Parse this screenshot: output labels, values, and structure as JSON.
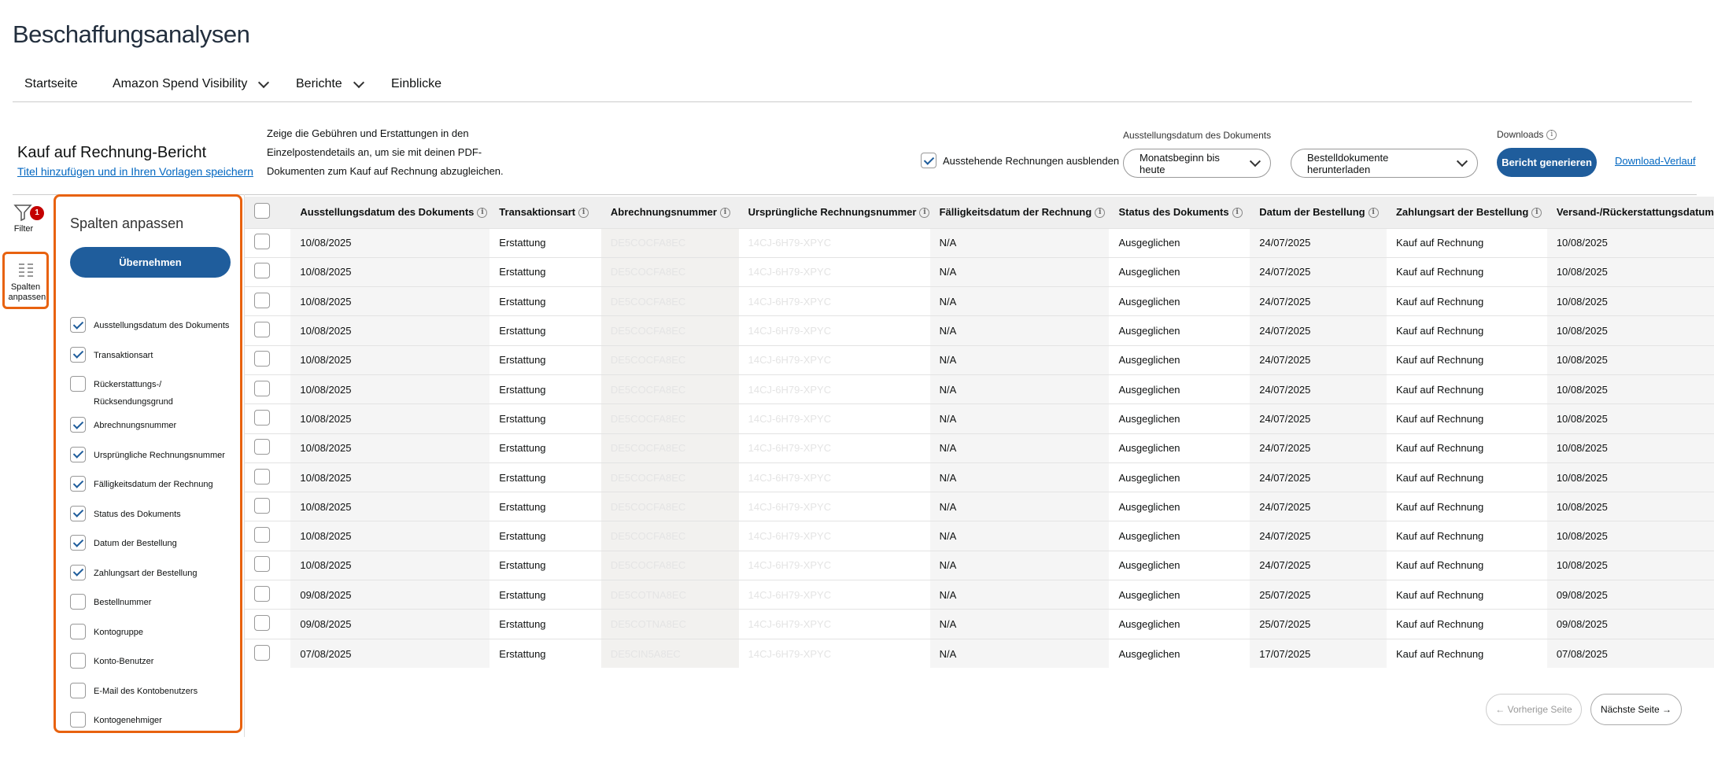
{
  "app_title": "Beschaffungsanalysen",
  "nav": [
    {
      "label": "Startseite",
      "dropdown": false
    },
    {
      "label": "Amazon Spend Visibility",
      "dropdown": true
    },
    {
      "label": "Berichte",
      "dropdown": true
    },
    {
      "label": "Einblicke",
      "dropdown": false
    }
  ],
  "report": {
    "title": "Kauf auf Rechnung-Bericht",
    "save_link": "Titel hinzufügen und in Ihren Vorlagen speichern",
    "description": "Zeige die Gebühren und Erstattungen in den Einzelpostendetails an, um sie mit deinen PDF-Dokumenten zum Kauf auf Rechnung abzugleichen."
  },
  "controls": {
    "hide_pending_label": "Ausstehende Rechnungen ausblenden",
    "hide_pending_checked": true,
    "date_label": "Ausstellungsdatum des Dokuments",
    "date_value": "Monatsbeginn bis heute",
    "docs_download": "Bestelldokumente herunterladen",
    "downloads_label": "Downloads",
    "generate_button": "Bericht generieren",
    "download_history": "Download-Verlauf"
  },
  "sidebar": {
    "filter_label": "Filter",
    "filter_count": "1",
    "columns_label": "Spalten anpassen"
  },
  "panel": {
    "title": "Spalten anpassen",
    "apply": "Übernehmen",
    "options": [
      {
        "label": "Ausstellungsdatum des Dokuments",
        "checked": true
      },
      {
        "label": "Transaktionsart",
        "checked": true
      },
      {
        "label": "Rückerstattungs-/ Rücksendungsgrund",
        "checked": false
      },
      {
        "label": "Abrechnungsnummer",
        "checked": true
      },
      {
        "label": "Ursprüngliche Rechnungsnummer",
        "checked": true
      },
      {
        "label": "Fälligkeitsdatum der Rechnung",
        "checked": true
      },
      {
        "label": "Status des Dokuments",
        "checked": true
      },
      {
        "label": "Datum der Bestellung",
        "checked": true
      },
      {
        "label": "Zahlungsart der Bestellung",
        "checked": true
      },
      {
        "label": "Bestellnummer",
        "checked": false
      },
      {
        "label": "Kontogruppe",
        "checked": false
      },
      {
        "label": "Konto-Benutzer",
        "checked": false
      },
      {
        "label": "E-Mail des Kontobenutzers",
        "checked": false
      },
      {
        "label": "Kontogenehmiger",
        "checked": false
      }
    ]
  },
  "table": {
    "columns": [
      {
        "label": "Ausstellungsdatum des Dokuments",
        "info": true
      },
      {
        "label": "Transaktionsart",
        "info": true
      },
      {
        "label": "Abrechnungsnummer",
        "info": true
      },
      {
        "label": "Ursprüngliche Rechnungsnummer",
        "info": true
      },
      {
        "label": "Fälligkeitsdatum der Rechnung",
        "info": true
      },
      {
        "label": "Status des Dokuments",
        "info": true
      },
      {
        "label": "Datum der Bestellung",
        "info": true
      },
      {
        "label": "Zahlungsart der Bestellung",
        "info": true
      },
      {
        "label": "Versand-/Rückerstattungsdatum",
        "info": false
      }
    ],
    "rows": [
      [
        "10/08/2025",
        "Erstattung",
        "DE5COCFA8EC",
        "14CJ-6H79-XPYC",
        "N/A",
        "Ausgeglichen",
        "24/07/2025",
        "Kauf auf Rechnung",
        "10/08/2025"
      ],
      [
        "10/08/2025",
        "Erstattung",
        "DE5COCFA8EC",
        "14CJ-6H79-XPYC",
        "N/A",
        "Ausgeglichen",
        "24/07/2025",
        "Kauf auf Rechnung",
        "10/08/2025"
      ],
      [
        "10/08/2025",
        "Erstattung",
        "DE5COCFA8EC",
        "14CJ-6H79-XPYC",
        "N/A",
        "Ausgeglichen",
        "24/07/2025",
        "Kauf auf Rechnung",
        "10/08/2025"
      ],
      [
        "10/08/2025",
        "Erstattung",
        "DE5COCFA8EC",
        "14CJ-6H79-XPYC",
        "N/A",
        "Ausgeglichen",
        "24/07/2025",
        "Kauf auf Rechnung",
        "10/08/2025"
      ],
      [
        "10/08/2025",
        "Erstattung",
        "DE5COCFA8EC",
        "14CJ-6H79-XPYC",
        "N/A",
        "Ausgeglichen",
        "24/07/2025",
        "Kauf auf Rechnung",
        "10/08/2025"
      ],
      [
        "10/08/2025",
        "Erstattung",
        "DE5COCFA8EC",
        "14CJ-6H79-XPYC",
        "N/A",
        "Ausgeglichen",
        "24/07/2025",
        "Kauf auf Rechnung",
        "10/08/2025"
      ],
      [
        "10/08/2025",
        "Erstattung",
        "DE5COCFA8EC",
        "14CJ-6H79-XPYC",
        "N/A",
        "Ausgeglichen",
        "24/07/2025",
        "Kauf auf Rechnung",
        "10/08/2025"
      ],
      [
        "10/08/2025",
        "Erstattung",
        "DE5COCFA8EC",
        "14CJ-6H79-XPYC",
        "N/A",
        "Ausgeglichen",
        "24/07/2025",
        "Kauf auf Rechnung",
        "10/08/2025"
      ],
      [
        "10/08/2025",
        "Erstattung",
        "DE5COCFA8EC",
        "14CJ-6H79-XPYC",
        "N/A",
        "Ausgeglichen",
        "24/07/2025",
        "Kauf auf Rechnung",
        "10/08/2025"
      ],
      [
        "10/08/2025",
        "Erstattung",
        "DE5COCFA8EC",
        "14CJ-6H79-XPYC",
        "N/A",
        "Ausgeglichen",
        "24/07/2025",
        "Kauf auf Rechnung",
        "10/08/2025"
      ],
      [
        "10/08/2025",
        "Erstattung",
        "DE5COCFA8EC",
        "14CJ-6H79-XPYC",
        "N/A",
        "Ausgeglichen",
        "24/07/2025",
        "Kauf auf Rechnung",
        "10/08/2025"
      ],
      [
        "10/08/2025",
        "Erstattung",
        "DE5COCFA8EC",
        "14CJ-6H79-XPYC",
        "N/A",
        "Ausgeglichen",
        "24/07/2025",
        "Kauf auf Rechnung",
        "10/08/2025"
      ],
      [
        "09/08/2025",
        "Erstattung",
        "DE5COTNA8EC",
        "14CJ-6H79-XPYC",
        "N/A",
        "Ausgeglichen",
        "25/07/2025",
        "Kauf auf Rechnung",
        "09/08/2025"
      ],
      [
        "09/08/2025",
        "Erstattung",
        "DE5COTNA8EC",
        "14CJ-6H79-XPYC",
        "N/A",
        "Ausgeglichen",
        "25/07/2025",
        "Kauf auf Rechnung",
        "09/08/2025"
      ],
      [
        "07/08/2025",
        "Erstattung",
        "DE5CIN5A8EC",
        "14CJ-6H79-XPYC",
        "N/A",
        "Ausgeglichen",
        "17/07/2025",
        "Kauf auf Rechnung",
        "07/08/2025"
      ]
    ]
  },
  "pagination": {
    "prev": "← Vorherige Seite",
    "next": "Nächste Seite →"
  },
  "colors": {
    "accent": "#1f5d9c",
    "highlight": "#e8620f",
    "badge": "#c40000"
  }
}
